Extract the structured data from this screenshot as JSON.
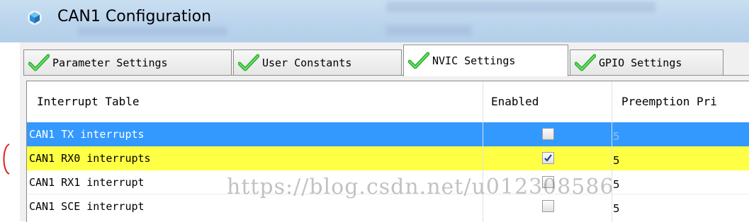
{
  "window": {
    "title": "CAN1 Configuration",
    "icon": "cube-icon"
  },
  "tabs": [
    {
      "label": "Parameter Settings",
      "icon": "green-check-icon",
      "active": false
    },
    {
      "label": "User Constants",
      "icon": "green-check-icon",
      "active": false
    },
    {
      "label": "NVIC Settings",
      "icon": "green-check-icon",
      "active": true
    },
    {
      "label": "GPIO Settings",
      "icon": "green-check-icon",
      "active": false
    }
  ],
  "table": {
    "headers": {
      "interrupt": "Interrupt Table",
      "enabled": "Enabled",
      "priority": "Preemption Pri"
    },
    "rows": [
      {
        "name": "CAN1 TX interrupts",
        "enabled": false,
        "priority": "5",
        "state": "selected"
      },
      {
        "name": "CAN1 RX0 interrupts",
        "enabled": true,
        "priority": "5",
        "state": "highlighted"
      },
      {
        "name": "CAN1 RX1 interrupt",
        "enabled": false,
        "priority": "5",
        "state": "normal"
      },
      {
        "name": "CAN1 SCE interrupt",
        "enabled": false,
        "priority": "5",
        "state": "normal"
      }
    ]
  },
  "watermark": "https://blog.csdn.net/u012308586",
  "colors": {
    "selection": "#3399ff",
    "highlight": "#ffff44",
    "check": "#2db52d",
    "annotation": "#e02020"
  }
}
